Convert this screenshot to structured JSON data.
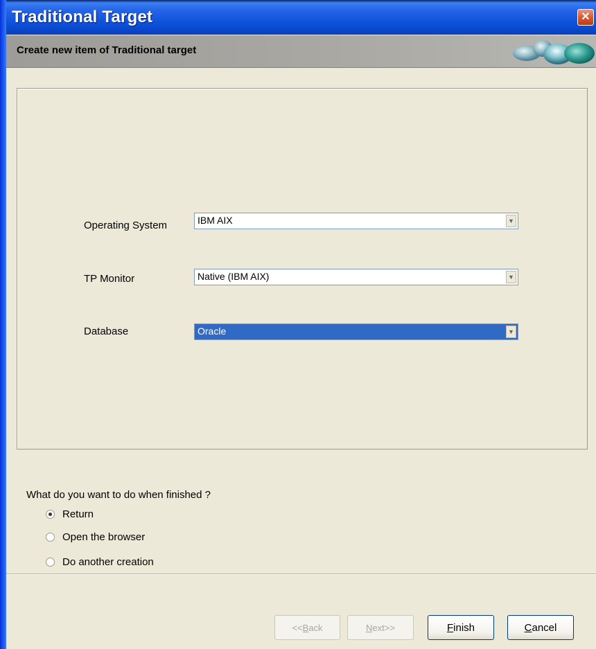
{
  "window": {
    "title": "Traditional Target"
  },
  "header": {
    "subtitle": "Create new item of Traditional target"
  },
  "form": {
    "operating_system": {
      "label": "Operating System",
      "value": "IBM AIX"
    },
    "tp_monitor": {
      "label": "TP Monitor",
      "value": "Native (IBM AIX)"
    },
    "database": {
      "label": "Database",
      "value": "Oracle"
    }
  },
  "finish_options": {
    "question": "What do you want to do when finished ?",
    "options": [
      {
        "label": "Return",
        "checked": true
      },
      {
        "label": "Open the browser",
        "checked": false
      },
      {
        "label": "Do another creation",
        "checked": false
      }
    ]
  },
  "buttons": {
    "back": {
      "prefix": "<<",
      "mnemonic": "B",
      "rest": "ack"
    },
    "next": {
      "mnemonic": "N",
      "rest": "ext>>"
    },
    "finish": {
      "mnemonic": "F",
      "rest": "inish"
    },
    "cancel": {
      "mnemonic": "C",
      "rest": "ancel"
    }
  },
  "colors": {
    "title_bar": "#0b50d8",
    "selection": "#316ac5",
    "window_bg": "#ece9d8"
  },
  "icons": {
    "close": "close-icon",
    "combo_arrow": "chevron-down-icon",
    "header_decoration": "orbs-graphic"
  }
}
